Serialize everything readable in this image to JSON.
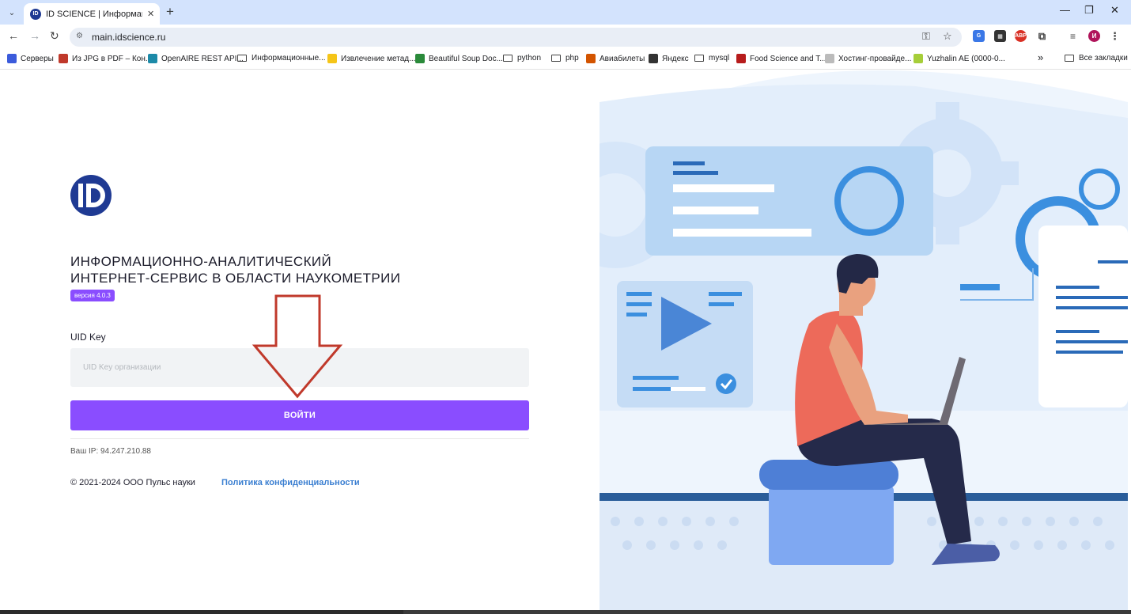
{
  "browser": {
    "tab_title": "ID SCIENCE | Информационно",
    "tab_favicon": "ID",
    "new_tab": "+",
    "url": "main.idscience.ru",
    "profile_initial": "И",
    "ext_abp": "ABP",
    "bookmarks": [
      {
        "label": "Серверы",
        "icon": "server-icon"
      },
      {
        "label": "Из JPG в PDF – Кон...",
        "icon": "convert-icon"
      },
      {
        "label": "OpenAIRE REST API...",
        "icon": "openaire-icon"
      },
      {
        "label": "Информационные...",
        "icon": "folder-icon"
      },
      {
        "label": "Извлечение метад...",
        "icon": "bulb-icon"
      },
      {
        "label": "Beautiful Soup Doc...",
        "icon": "c-icon"
      },
      {
        "label": "python",
        "icon": "folder-icon"
      },
      {
        "label": "php",
        "icon": "folder-icon"
      },
      {
        "label": "Авиабилеты",
        "icon": "plane-icon"
      },
      {
        "label": "Яндекс",
        "icon": "globe-icon"
      },
      {
        "label": "mysql",
        "icon": "folder-icon"
      },
      {
        "label": "Food Science and T...",
        "icon": "pd-icon"
      },
      {
        "label": "Хостинг-провайде...",
        "icon": "hosting-icon"
      },
      {
        "label": "Yuzhalin AE (0000-0...",
        "icon": "orcid-icon"
      }
    ],
    "bookmarks_more": "»",
    "all_bookmarks": "Все закладки"
  },
  "login": {
    "logo_letters": "ID",
    "headline_line1": "ИНФОРМАЦИОННО-АНАЛИТИЧЕСКИЙ",
    "headline_line2": "ИНТЕРНЕТ-СЕРВИС В ОБЛАСТИ НАУКОМЕТРИИ",
    "version": "версия 4.0.3",
    "uid_label": "UID Key",
    "uid_placeholder": "UID Key организации",
    "uid_value": "",
    "login_button": "ВОЙТИ",
    "ip": "Ваш IP: 94.247.210.88",
    "copyright": "© 2021-2024  ООО Пульс науки",
    "privacy": "Политика конфиденциальности"
  },
  "colors": {
    "accent": "#8a4dff",
    "arrow": "#c0392b",
    "link": "#3b7fd1",
    "logo": "#1f3a93"
  }
}
